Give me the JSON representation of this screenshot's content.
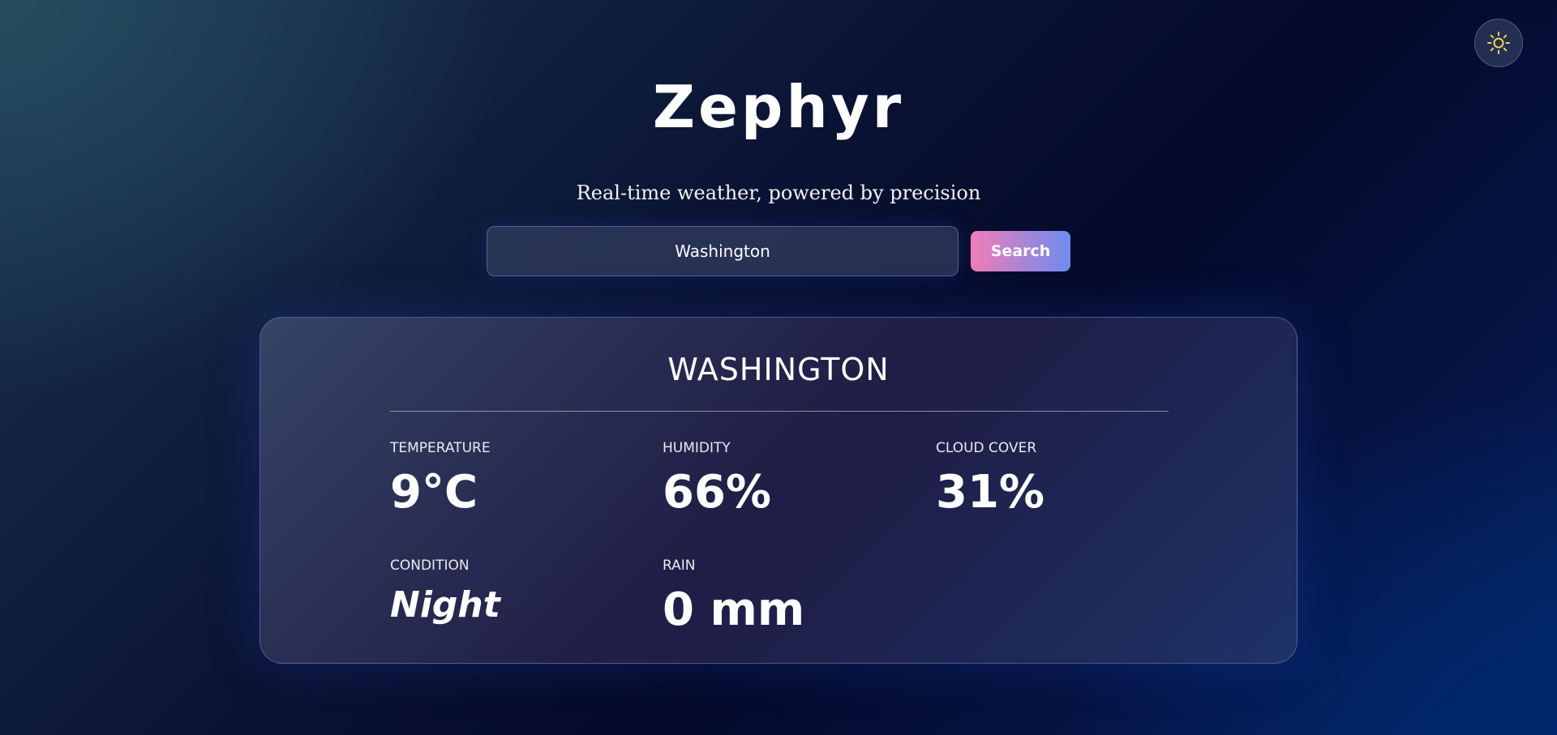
{
  "app": {
    "title": "Zephyr",
    "tagline": "Real-time weather, powered by precision"
  },
  "theme_toggle": {
    "icon": "sun-icon",
    "icon_color": "#f5d24a"
  },
  "search": {
    "value": "Washington",
    "button_label": "Search"
  },
  "weather": {
    "city": "WASHINGTON",
    "stats": {
      "temperature": {
        "label": "TEMPERATURE",
        "value": "9°C"
      },
      "humidity": {
        "label": "HUMIDITY",
        "value": "66%"
      },
      "cloud_cover": {
        "label": "CLOUD COVER",
        "value": "31%"
      },
      "condition": {
        "label": "CONDITION",
        "value": "Night"
      },
      "rain": {
        "label": "RAIN",
        "value": "0 mm"
      }
    }
  },
  "colors": {
    "button_gradient_start": "#f07db8",
    "button_gradient_end": "#6f8cf0",
    "text": "#ffffff"
  }
}
